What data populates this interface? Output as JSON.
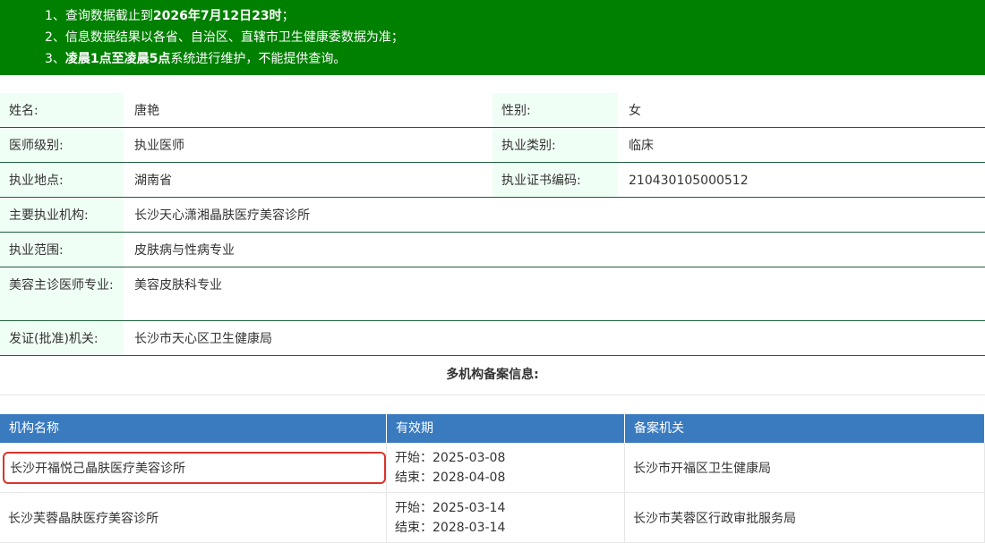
{
  "notice": {
    "line1_pre": "1、查询数据截止到",
    "line1_bold": "2026年7月12日23时",
    "line1_post": "；",
    "line2": "2、信息数据结果以各省、自治区、直辖市卫生健康委数据为准；",
    "line3_pre": "3、",
    "line3_bold": "凌晨1点至凌晨5点",
    "line3_post": "系统进行维护，不能提供查询。"
  },
  "info": {
    "name_label": "姓名:",
    "name": "唐艳",
    "gender_label": "性别:",
    "gender": "女",
    "level_label": "医师级别:",
    "level": "执业医师",
    "category_label": "执业类别:",
    "category": "临床",
    "location_label": "执业地点:",
    "location": "湖南省",
    "cert_label": "执业证书编码:",
    "cert": "210430105000512",
    "org_label": "主要执业机构:",
    "org": "长沙天心潇湘晶肤医疗美容诊所",
    "scope_label": "执业范围:",
    "scope": "皮肤病与性病专业",
    "beauty_label": "美容主诊医师专业:",
    "beauty": "美容皮肤科专业",
    "issuer_label": "发证(批准)机关:",
    "issuer": "长沙市天心区卫生健康局"
  },
  "multi_title": "多机构备案信息:",
  "table": {
    "headers": [
      "机构名称",
      "有效期",
      "备案机关"
    ],
    "rows": [
      {
        "name": "长沙开福悦己晶肤医疗美容诊所",
        "start": "开始：2025-03-08",
        "end": "结束：2028-04-08",
        "authority": "长沙市开福区卫生健康局"
      },
      {
        "name": "长沙芙蓉晶肤医疗美容诊所",
        "start": "开始：2025-03-14",
        "end": "结束：2028-03-14",
        "authority": "长沙市芙蓉区行政审批服务局"
      }
    ]
  },
  "colors": {
    "banner": "#008000",
    "header": "#3a7bbf",
    "highlight": "#d9342b"
  }
}
